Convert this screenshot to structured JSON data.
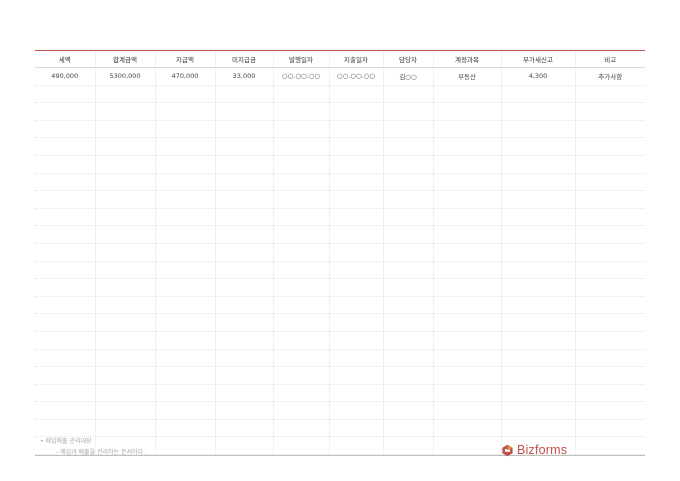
{
  "table": {
    "headers": [
      "세액",
      "합계금액",
      "지급액",
      "미지급금",
      "발행일자",
      "지출일자",
      "담당자",
      "계정과목",
      "부가세신고",
      "비고"
    ],
    "rows": [
      [
        "490,000",
        "5300,000",
        "470,000",
        "33,000",
        "○○.○○.○○",
        "○○.○○.○○",
        "김○○",
        "부동산",
        "4,300",
        "추가사항"
      ]
    ]
  },
  "notes": {
    "title": "매입매출 관리대장",
    "description": "- 매입과 매출을 관리하는 문서이다."
  },
  "brand": {
    "name": "Bizforms",
    "color": "#c0504d",
    "icon": "bizforms-logo-icon"
  }
}
